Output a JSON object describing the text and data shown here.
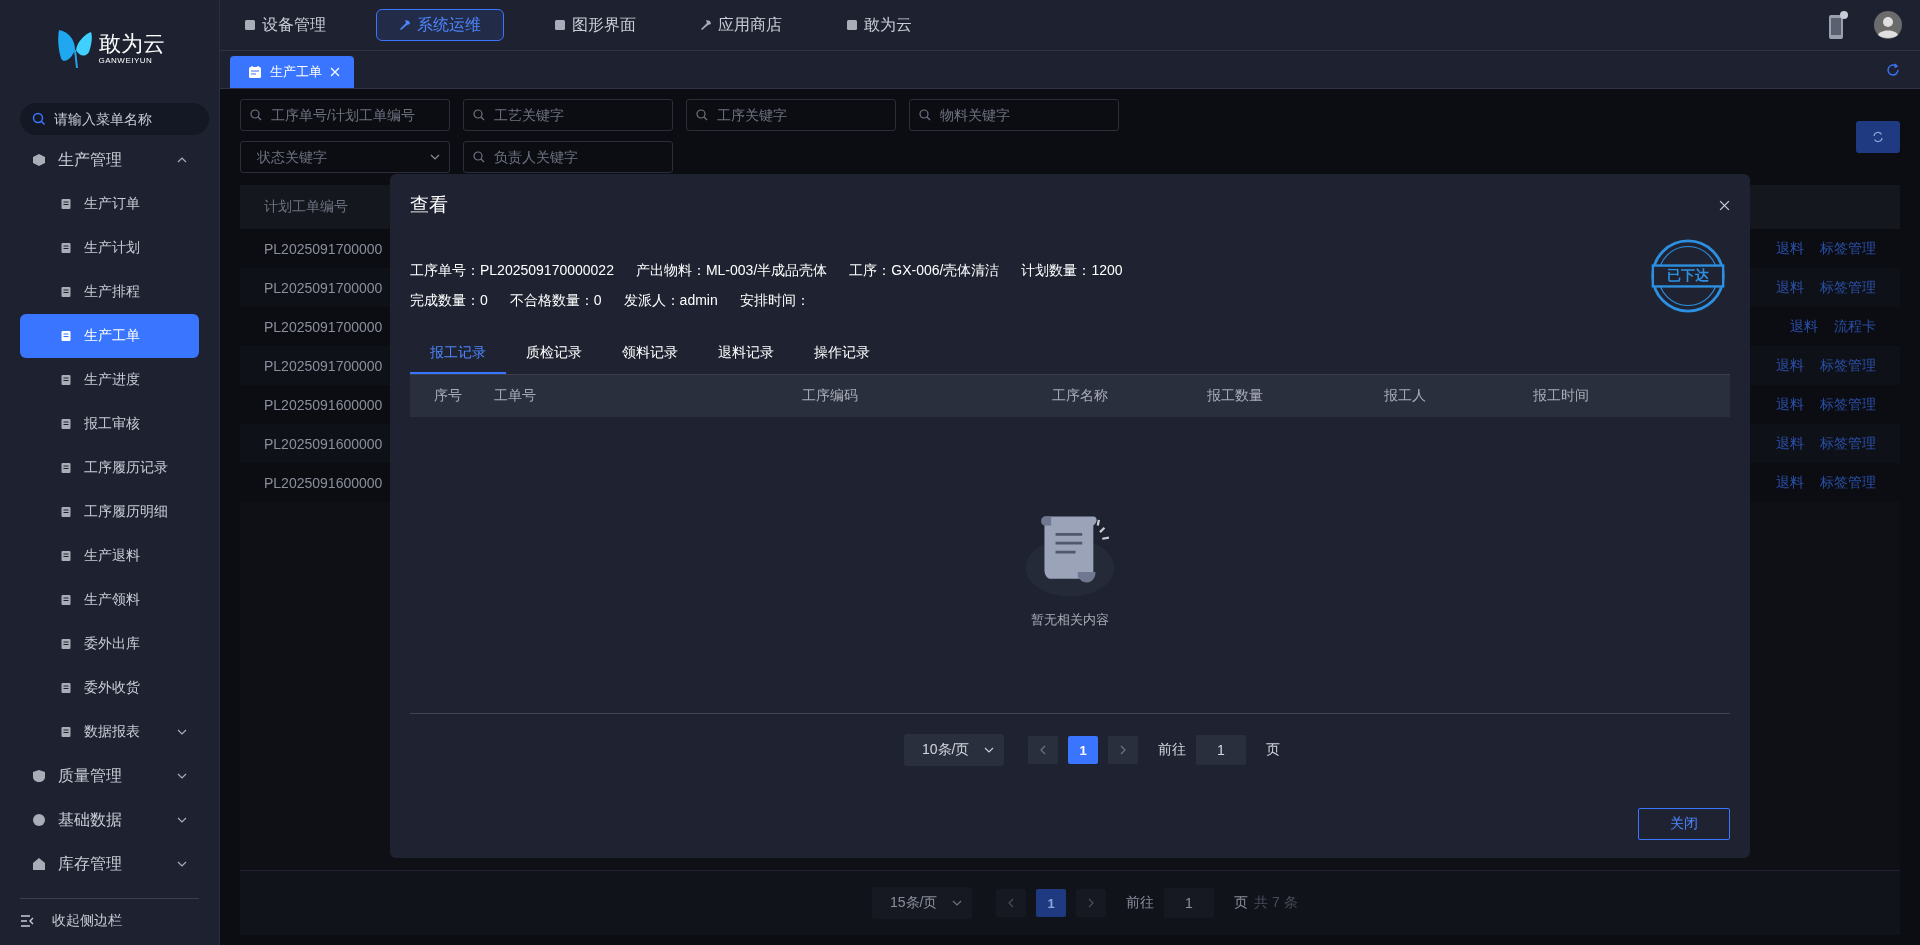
{
  "logo": {
    "name": "敢为云",
    "subtitle": "GANWEIYUN"
  },
  "sidebar": {
    "search": {
      "placeholder": "请输入菜单名称"
    },
    "items": [
      {
        "label": "生产管理",
        "kind": "group",
        "expanded": true,
        "selected": false,
        "children": [
          {
            "label": "生产订单",
            "kind": "page",
            "selected": false
          },
          {
            "label": "生产计划",
            "kind": "page",
            "selected": false
          },
          {
            "label": "生产排程",
            "kind": "page",
            "selected": false
          },
          {
            "label": "生产工单",
            "kind": "page",
            "selected": true
          },
          {
            "label": "生产进度",
            "kind": "page",
            "selected": false
          },
          {
            "label": "报工审核",
            "kind": "page",
            "selected": false
          },
          {
            "label": "工序履历记录",
            "kind": "page",
            "selected": false
          },
          {
            "label": "工序履历明细",
            "kind": "page",
            "selected": false
          },
          {
            "label": "生产退料",
            "kind": "page",
            "selected": false
          },
          {
            "label": "生产领料",
            "kind": "page",
            "selected": false
          },
          {
            "label": "委外出库",
            "kind": "page",
            "selected": false
          },
          {
            "label": "委外收货",
            "kind": "page",
            "selected": false
          },
          {
            "label": "数据报表",
            "kind": "group",
            "expanded": false,
            "selected": false
          }
        ]
      },
      {
        "label": "质量管理",
        "kind": "group",
        "expanded": false,
        "selected": false
      },
      {
        "label": "基础数据",
        "kind": "group",
        "expanded": false,
        "selected": false
      },
      {
        "label": "库存管理",
        "kind": "group",
        "expanded": false,
        "selected": false
      }
    ],
    "collapse_label": "收起侧边栏"
  },
  "top_nav": [
    {
      "label": "设备管理",
      "selected": false
    },
    {
      "label": "系统运维",
      "selected": true
    },
    {
      "label": "图形界面",
      "selected": false
    },
    {
      "label": "应用商店",
      "selected": false
    },
    {
      "label": "敢为云",
      "selected": false
    }
  ],
  "page_tabs": [
    {
      "label": "生产工单",
      "selected": true
    }
  ],
  "filters": [
    {
      "kind": "search",
      "placeholder": "工序单号/计划工单编号"
    },
    {
      "kind": "search",
      "placeholder": "工艺关键字"
    },
    {
      "kind": "search",
      "placeholder": "工序关键字"
    },
    {
      "kind": "search",
      "placeholder": "物料关键字"
    },
    {
      "kind": "select",
      "placeholder": "状态关键字"
    },
    {
      "kind": "search",
      "placeholder": "负责人关键字"
    }
  ],
  "table": {
    "columns": [
      "计划工单编号"
    ],
    "rows": [
      {
        "order_no": "PL2025091700000",
        "actions": [
          "退料",
          "标签管理"
        ]
      },
      {
        "order_no": "PL2025091700000",
        "actions": [
          "退料",
          "标签管理"
        ]
      },
      {
        "order_no": "PL2025091700000",
        "actions": [
          "退料",
          "流程卡"
        ]
      },
      {
        "order_no": "PL2025091700000",
        "actions": [
          "退料",
          "标签管理"
        ]
      },
      {
        "order_no": "PL2025091600000",
        "actions": [
          "退料",
          "标签管理"
        ]
      },
      {
        "order_no": "PL2025091600000",
        "actions": [
          "退料",
          "标签管理"
        ]
      },
      {
        "order_no": "PL2025091600000",
        "actions": [
          "退料",
          "标签管理"
        ]
      }
    ]
  },
  "pagination": {
    "page_size": "15条/页",
    "pages": [
      {
        "label": "1",
        "selected": true
      }
    ],
    "goto_label": "前往",
    "goto_value": "1",
    "page_unit": "页",
    "total": "共 7 条"
  },
  "dialog": {
    "title": "查看",
    "stamp": "已下达",
    "info_lines": [
      [
        {
          "label": "工序单号：",
          "value": "PL202509170000022"
        },
        {
          "label": "产出物料：",
          "value": "ML-003/半成品壳体"
        },
        {
          "label": "工序：",
          "value": "GX-006/壳体清洁"
        },
        {
          "label": "计划数量：",
          "value": "1200"
        }
      ],
      [
        {
          "label": "完成数量：",
          "value": "0"
        },
        {
          "label": "不合格数量：",
          "value": "0"
        },
        {
          "label": "发派人：",
          "value": "admin"
        },
        {
          "label": "安排时间："
        }
      ]
    ],
    "tabs": [
      {
        "label": "报工记录",
        "selected": true
      },
      {
        "label": "质检记录",
        "selected": false
      },
      {
        "label": "领料记录",
        "selected": false
      },
      {
        "label": "退料记录",
        "selected": false
      },
      {
        "label": "操作记录",
        "selected": false
      }
    ],
    "columns": [
      "序号",
      "工单号",
      "工序编码",
      "工序名称",
      "报工数量",
      "报工人",
      "报工时间"
    ],
    "empty_text": "暂无相关内容",
    "pagination": {
      "page_size": "10条/页",
      "pages": [
        {
          "label": "1",
          "selected": true
        }
      ],
      "goto_label": "前往",
      "goto_value": "1",
      "page_unit": "页"
    },
    "close_button": "关闭"
  }
}
